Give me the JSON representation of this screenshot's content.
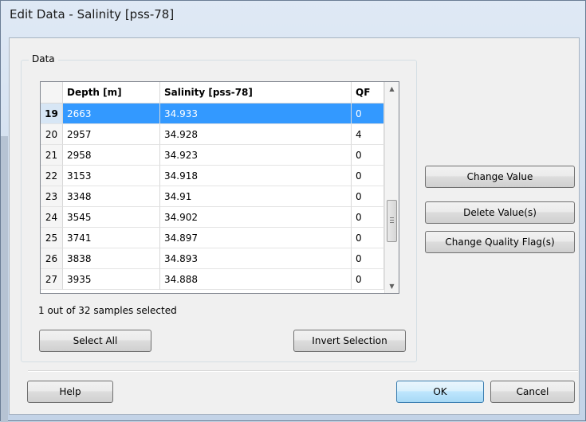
{
  "window": {
    "title": "Edit Data - Salinity [pss-78]"
  },
  "data_group": {
    "label": "Data"
  },
  "table": {
    "columns": [
      "Depth [m]",
      "Salinity [pss-78]",
      "QF"
    ],
    "rows": [
      {
        "num": "19",
        "depth": "2663",
        "salinity": "34.933",
        "qf": "0",
        "selected": true
      },
      {
        "num": "20",
        "depth": "2957",
        "salinity": "34.928",
        "qf": "4",
        "selected": false
      },
      {
        "num": "21",
        "depth": "2958",
        "salinity": "34.923",
        "qf": "0",
        "selected": false
      },
      {
        "num": "22",
        "depth": "3153",
        "salinity": "34.918",
        "qf": "0",
        "selected": false
      },
      {
        "num": "23",
        "depth": "3348",
        "salinity": "34.91",
        "qf": "0",
        "selected": false
      },
      {
        "num": "24",
        "depth": "3545",
        "salinity": "34.902",
        "qf": "0",
        "selected": false
      },
      {
        "num": "25",
        "depth": "3741",
        "salinity": "34.897",
        "qf": "0",
        "selected": false
      },
      {
        "num": "26",
        "depth": "3838",
        "salinity": "34.893",
        "qf": "0",
        "selected": false
      },
      {
        "num": "27",
        "depth": "3935",
        "salinity": "34.888",
        "qf": "0",
        "selected": false
      }
    ]
  },
  "status_text": "1 out of 32 samples selected",
  "buttons": {
    "select_all": "Select All",
    "invert_selection": "Invert Selection",
    "change_value": "Change Value",
    "delete_values": "Delete Value(s)",
    "change_quality_flags": "Change Quality Flag(s)",
    "help": "Help",
    "ok": "OK",
    "cancel": "Cancel"
  },
  "icons": {
    "scroll_up": "scroll-up-arrow-icon",
    "scroll_down": "scroll-down-arrow-icon",
    "thumb_grip": "grip-icon"
  }
}
